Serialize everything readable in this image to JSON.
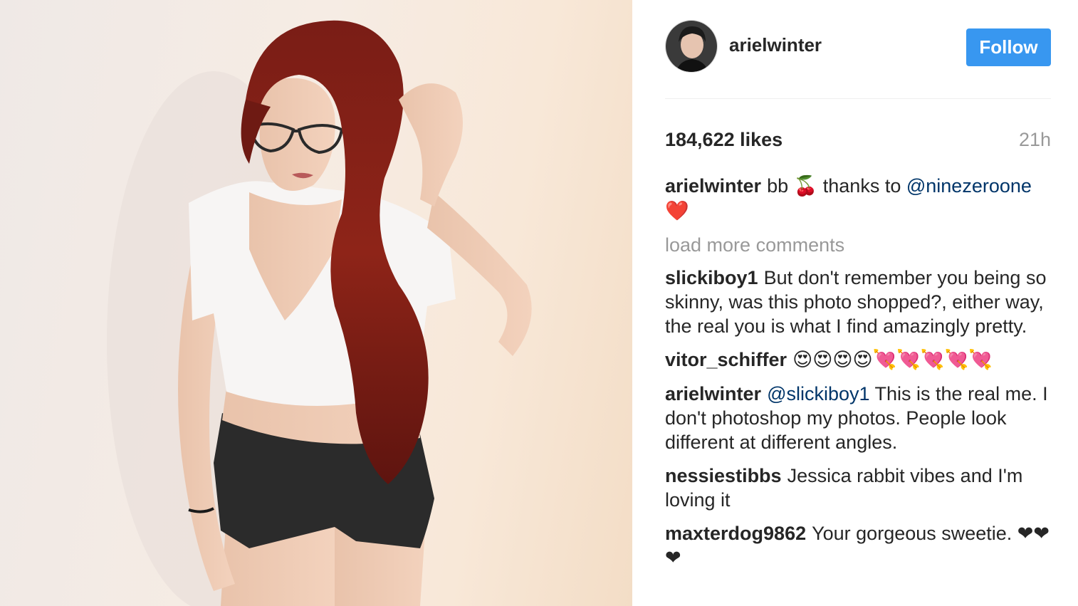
{
  "post": {
    "author": "arielwinter",
    "follow_label": "Follow",
    "likes": "184,622 likes",
    "timestamp": "21h",
    "caption": {
      "user": "arielwinter",
      "text_before": "bb",
      "emoji_1": "🍒",
      "text_after": "thanks to",
      "mention": "@ninezeroone",
      "emoji_2": "❤️"
    },
    "load_more": "load more comments",
    "comments": [
      {
        "user": "slickiboy1",
        "mention": "",
        "text": "But don't remember you being so skinny, was this photo shopped?, either way, the real you is what I find amazingly pretty."
      },
      {
        "user": "vitor_schiffer",
        "mention": "",
        "text": "😍😍😍😍💘💘💘💘💘"
      },
      {
        "user": "arielwinter",
        "mention": "@slickiboy1",
        "text": "This is the real me. I don't photoshop my photos. People look different at different angles."
      },
      {
        "user": "nessiestibbs",
        "mention": "",
        "text": "Jessica rabbit vibes and I'm loving it"
      },
      {
        "user": "maxterdog9862",
        "mention": "",
        "text": "Your gorgeous sweetie. ❤❤❤"
      }
    ]
  },
  "colors": {
    "follow_button": "#3897f0",
    "mention": "#003569",
    "muted": "#999999",
    "text": "#262626"
  }
}
